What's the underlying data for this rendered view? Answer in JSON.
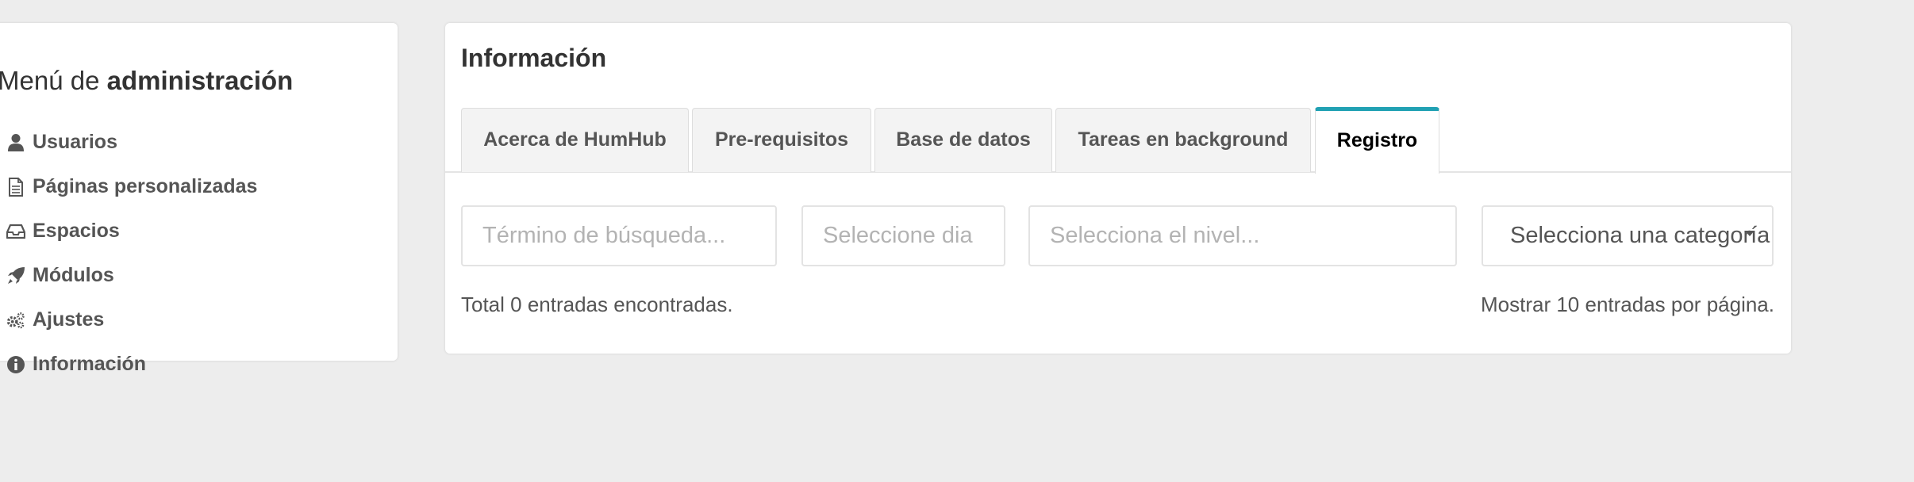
{
  "sidebar": {
    "title_prefix": "Menú de ",
    "title_bold": "administración",
    "items": [
      {
        "label": "Usuarios",
        "icon": "user-icon"
      },
      {
        "label": "Páginas personalizadas",
        "icon": "file-icon"
      },
      {
        "label": "Espacios",
        "icon": "inbox-icon"
      },
      {
        "label": "Módulos",
        "icon": "rocket-icon"
      },
      {
        "label": "Ajustes",
        "icon": "gears-icon"
      },
      {
        "label": "Información",
        "icon": "info-icon"
      }
    ]
  },
  "main": {
    "title": "Información",
    "tabs": [
      {
        "label": "Acerca de HumHub",
        "active": false
      },
      {
        "label": "Pre-requisitos",
        "active": false
      },
      {
        "label": "Base de datos",
        "active": false
      },
      {
        "label": "Tareas en background",
        "active": false
      },
      {
        "label": "Registro",
        "active": true
      }
    ],
    "filters": {
      "search_placeholder": "Término de búsqueda...",
      "day_placeholder": "Seleccione dia",
      "level_placeholder": "Selecciona el nivel...",
      "category_value": "Selecciona una categoría"
    },
    "total_text": "Total 0 entradas encontradas.",
    "per_page_text": "Mostrar 10 entradas por página."
  },
  "colors": {
    "background": "#ededed",
    "panel": "#ffffff",
    "accent": "#21a1b3",
    "text": "#555555"
  }
}
